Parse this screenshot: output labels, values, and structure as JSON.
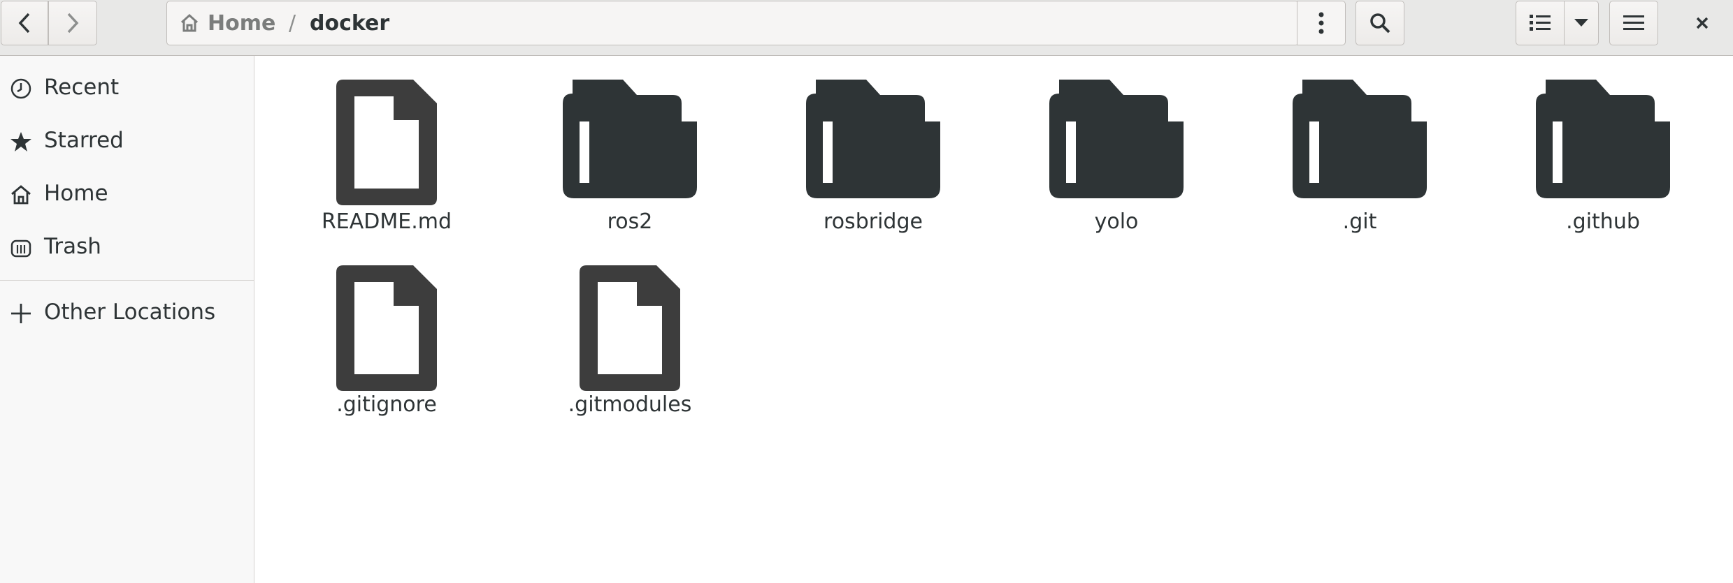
{
  "headerbar": {
    "back_icon": "go-previous-icon",
    "forward_icon": "go-next-icon",
    "path": {
      "home_label": "Home",
      "separator": "/",
      "current_label": "docker"
    },
    "menu_icon": "view-more-vertical-icon",
    "search_icon": "search-icon",
    "view_icon": "list-view-icon",
    "view_dropdown_icon": "triangle-down-icon",
    "hamburger_icon": "open-menu-icon",
    "close_icon": "close-icon"
  },
  "sidebar": {
    "items": [
      {
        "label": "Recent",
        "icon": "clock-icon"
      },
      {
        "label": "Starred",
        "icon": "star-icon"
      },
      {
        "label": "Home",
        "icon": "home-icon"
      },
      {
        "label": "Trash",
        "icon": "trash-icon"
      }
    ],
    "other_locations": {
      "label": "Other Locations",
      "icon": "plus-icon"
    }
  },
  "files": [
    {
      "name": "README.md",
      "type": "file"
    },
    {
      "name": "ros2",
      "type": "folder"
    },
    {
      "name": "rosbridge",
      "type": "folder"
    },
    {
      "name": "yolo",
      "type": "folder"
    },
    {
      "name": ".git",
      "type": "folder"
    },
    {
      "name": ".github",
      "type": "folder"
    },
    {
      "name": ".gitignore",
      "type": "file"
    },
    {
      "name": ".gitmodules",
      "type": "file"
    }
  ],
  "colors": {
    "header_bg": "#e8e8e7",
    "sidebar_bg": "#f8f8f8",
    "folder_icon": "#2e3436",
    "file_icon": "#3d3d3d"
  }
}
